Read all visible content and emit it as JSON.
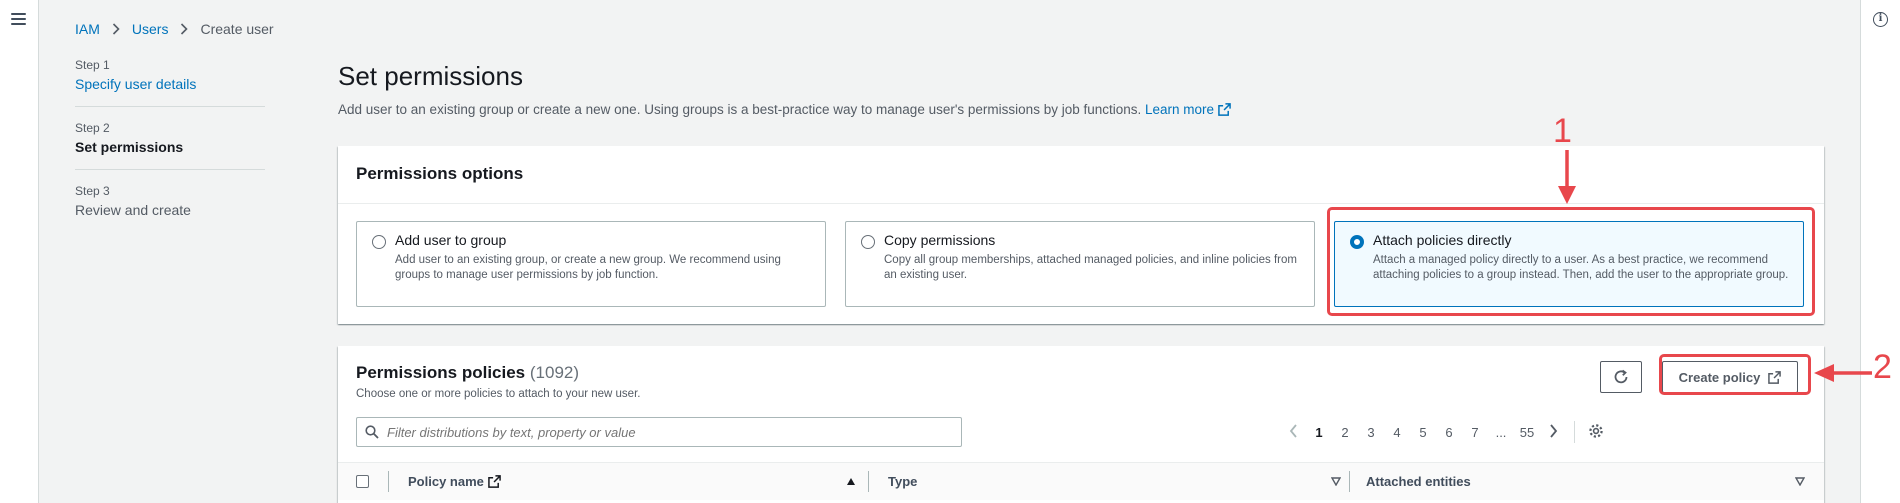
{
  "breadcrumb": {
    "items": [
      "IAM",
      "Users"
    ],
    "current": "Create user"
  },
  "steps": [
    {
      "num": "Step 1",
      "title": "Specify user details"
    },
    {
      "num": "Step 2",
      "title": "Set permissions"
    },
    {
      "num": "Step 3",
      "title": "Review and create"
    }
  ],
  "page": {
    "title": "Set permissions",
    "description": "Add user to an existing group or create a new one. Using groups is a best-practice way to manage user's permissions by job functions.",
    "learn_more": "Learn more"
  },
  "permission_options": {
    "heading": "Permissions options",
    "tiles": [
      {
        "title": "Add user to group",
        "desc": "Add user to an existing group, or create a new group. We recommend using groups to manage user permissions by job function.",
        "selected": false
      },
      {
        "title": "Copy permissions",
        "desc": "Copy all group memberships, attached managed policies, and inline policies from an existing user.",
        "selected": false
      },
      {
        "title": "Attach policies directly",
        "desc": "Attach a managed policy directly to a user. As a best practice, we recommend attaching policies to a group instead. Then, add the user to the appropriate group.",
        "selected": true
      }
    ]
  },
  "policies": {
    "heading": "Permissions policies",
    "count": "(1092)",
    "subtitle": "Choose one or more policies to attach to your new user.",
    "create_label": "Create policy",
    "filter_placeholder": "Filter distributions by text, property or value",
    "pages": [
      "1",
      "2",
      "3",
      "4",
      "5",
      "6",
      "7"
    ],
    "ellipsis": "...",
    "last_page": "55",
    "columns": [
      "Policy name",
      "Type",
      "Attached entities"
    ]
  },
  "annotations": {
    "first": "1",
    "second": "2"
  },
  "colors": {
    "link": "#0073bb",
    "annotation": "#e8474c",
    "selected_bg": "#f1faff"
  }
}
